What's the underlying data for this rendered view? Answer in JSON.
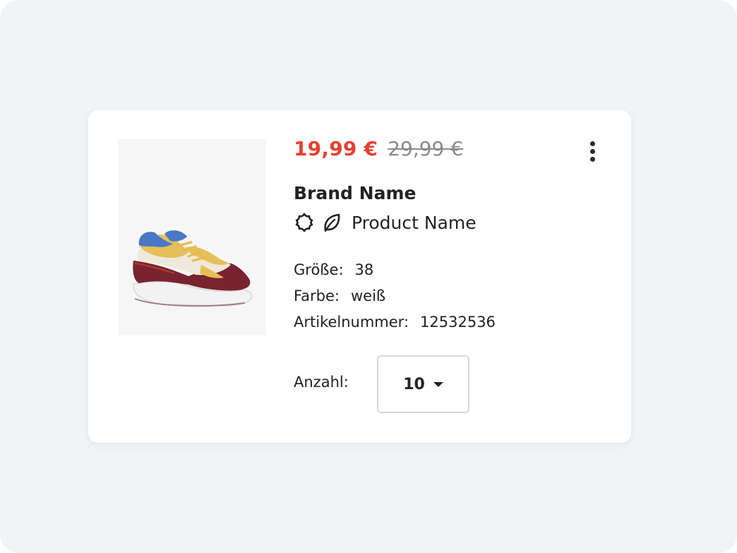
{
  "product": {
    "price_current": "19,99 €",
    "price_old": "29,99 €",
    "brand": "Brand Name",
    "name": "Product Name",
    "badges": [
      "flower-badge-icon",
      "leaf-icon"
    ],
    "image": "sneaker-image"
  },
  "attributes": [
    {
      "label": "Größe:",
      "value": "38"
    },
    {
      "label": "Farbe:",
      "value": "weiß"
    },
    {
      "label": "Artikelnummer:",
      "value": "12532536"
    }
  ],
  "quantity": {
    "label": "Anzahl:",
    "value": "10"
  },
  "menu": {
    "icon": "more-vertical-icon"
  },
  "colors": {
    "price_accent": "#e64132",
    "old_price": "#8a8a8a",
    "page_background": "#f0f4f7",
    "card_background": "#ffffff"
  }
}
